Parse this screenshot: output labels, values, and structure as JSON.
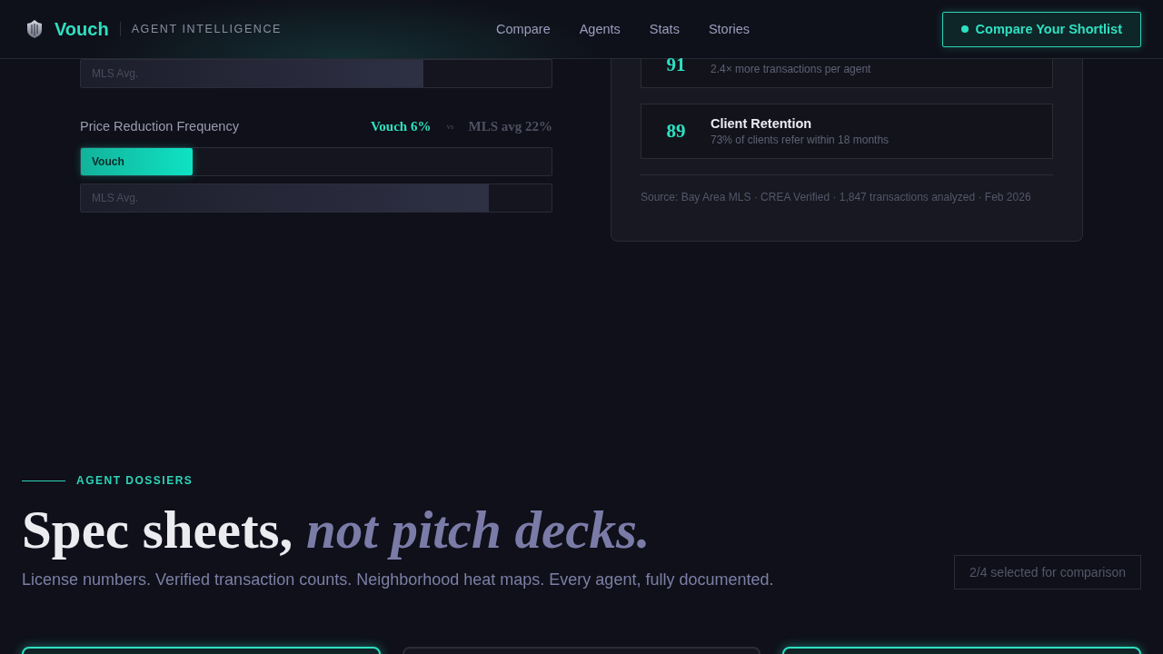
{
  "header": {
    "brand": "Vouch",
    "tagline": "AGENT INTELLIGENCE",
    "nav": [
      {
        "label": "Compare"
      },
      {
        "label": "Agents"
      },
      {
        "label": "Stats"
      },
      {
        "label": "Stories"
      }
    ],
    "cta": "Compare Your Shortlist"
  },
  "comparison": {
    "metrics": [
      {
        "bars": [
          {
            "label": "MLS Avg.",
            "kind": "mls",
            "level": 0.727
          }
        ]
      },
      {
        "label": "Price Reduction Frequency",
        "vouch_value": "Vouch 6%",
        "vs": "vs",
        "mls_value": "MLS avg 22%",
        "bars": [
          {
            "label": "Vouch",
            "kind": "vouch",
            "level": 0.238
          },
          {
            "label": "MLS Avg.",
            "kind": "mls",
            "level": 0.867
          }
        ]
      }
    ]
  },
  "scores": {
    "rows": [
      {
        "score": "91",
        "detail": "2.4× more transactions per agent"
      },
      {
        "score": "89",
        "title": "Client Retention",
        "detail": "73% of clients refer within 18 months"
      }
    ],
    "source": "Source: Bay Area MLS · CREA Verified · 1,847 transactions analyzed · Feb 2026"
  },
  "dossiers": {
    "eyebrow": "AGENT DOSSIERS",
    "heading": "Spec sheets, *not pitch decks.*",
    "subtitle": "License numbers. Verified transaction counts. Neighborhood heat maps. Every agent, fully documented.",
    "selection": "2/4 selected for comparison",
    "cards": [
      {
        "selected": true
      },
      {
        "selected": false
      },
      {
        "selected": true
      }
    ]
  }
}
